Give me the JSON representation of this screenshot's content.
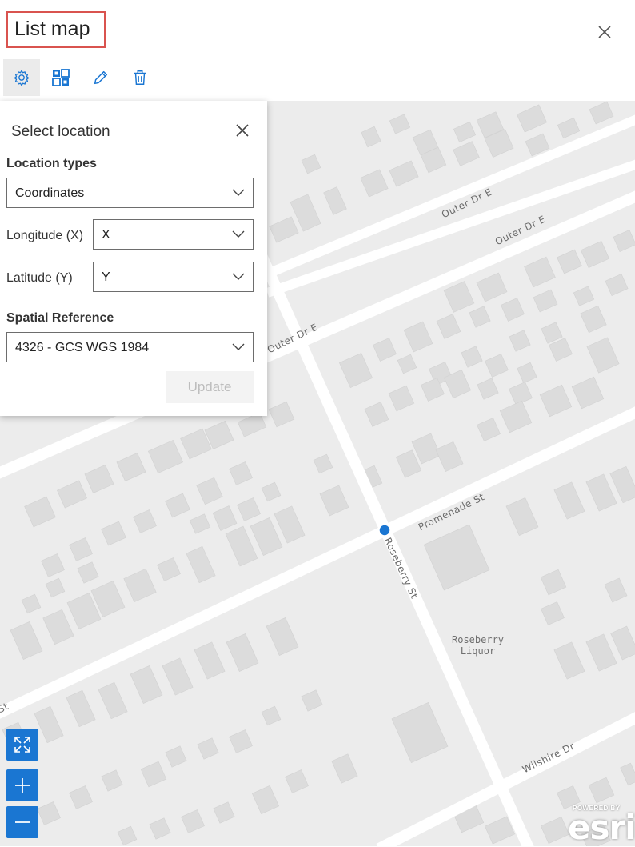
{
  "header": {
    "title": "List map",
    "close_icon": "close-icon"
  },
  "toolbar": {
    "buttons": [
      {
        "name": "settings",
        "icon": "gear-icon",
        "active": true
      },
      {
        "name": "layout",
        "icon": "grid-icon"
      },
      {
        "name": "edit",
        "icon": "pencil-icon"
      },
      {
        "name": "delete",
        "icon": "trash-icon"
      }
    ]
  },
  "panel": {
    "title": "Select location",
    "location_types_label": "Location types",
    "location_type_value": "Coordinates",
    "longitude_label": "Longitude (X)",
    "longitude_value": "X",
    "latitude_label": "Latitude (Y)",
    "latitude_value": "Y",
    "spatial_reference_label": "Spatial Reference",
    "spatial_reference_value": "4326 - GCS WGS 1984",
    "update_label": "Update"
  },
  "map": {
    "streets": [
      "Outer Dr E",
      "Outer Dr E",
      "Outer Dr E",
      "Promenade St",
      "Roseberry St",
      "Wilshire Dr",
      "St"
    ],
    "poi": "Roseberry\nLiquor",
    "attribution_powered": "POWERED BY",
    "attribution_logo": "esri",
    "colors": {
      "background": "#ececec",
      "road": "#ffffff",
      "building": "#dcdcdc",
      "marker": "#1a76d2"
    }
  }
}
